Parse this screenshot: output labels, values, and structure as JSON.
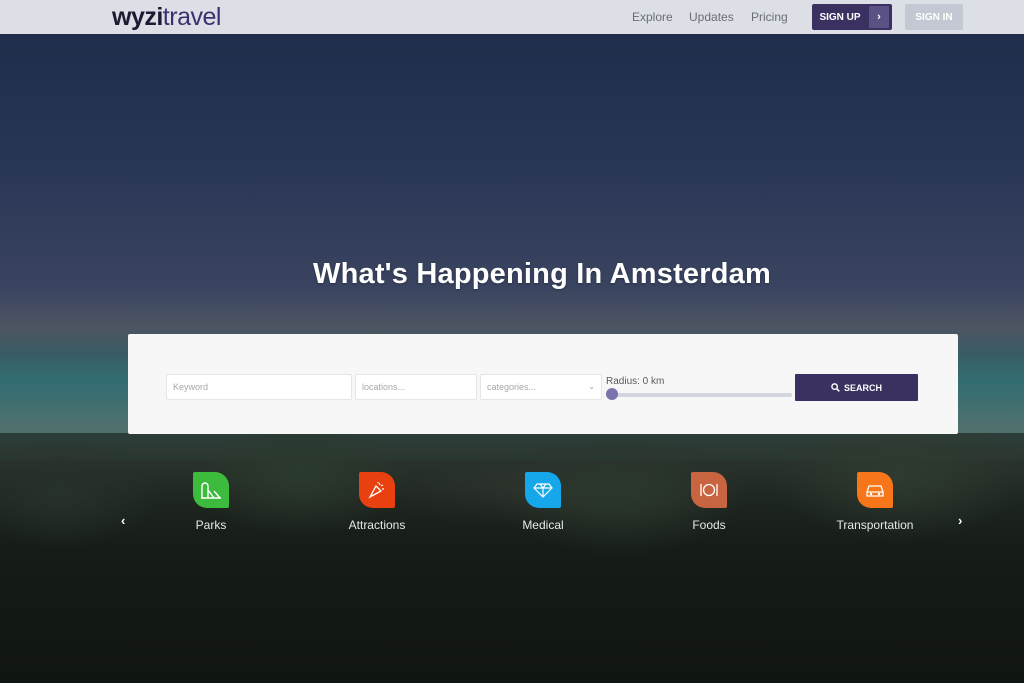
{
  "header": {
    "logo_prefix": "wyzi",
    "logo_suffix": "travel",
    "nav": [
      "Explore",
      "Updates",
      "Pricing"
    ],
    "signup_label": "SIGN UP",
    "signup_chevron": "›",
    "signin_label": "SIGN IN"
  },
  "hero": {
    "title": "What's Happening In Amsterdam"
  },
  "search": {
    "keyword_placeholder": "Keyword",
    "locations_placeholder": "locations...",
    "categories_placeholder": "categories...",
    "radius_label": "Radius: 0 km",
    "radius_value_km": 0,
    "button_label": "SEARCH"
  },
  "categories": [
    {
      "label": "Parks",
      "icon": "park-icon",
      "color": "#3dbb3d"
    },
    {
      "label": "Attractions",
      "icon": "party-popper-icon",
      "color": "#e8410f"
    },
    {
      "label": "Medical",
      "icon": "diamond-icon",
      "color": "#16a6ea"
    },
    {
      "label": "Foods",
      "icon": "plate-cutlery-icon",
      "color": "#c8643f"
    },
    {
      "label": "Transportation",
      "icon": "car-icon",
      "color": "#f7761a"
    }
  ],
  "colors": {
    "brand": "#3a3160",
    "header_bg": "#dcdfe6"
  }
}
